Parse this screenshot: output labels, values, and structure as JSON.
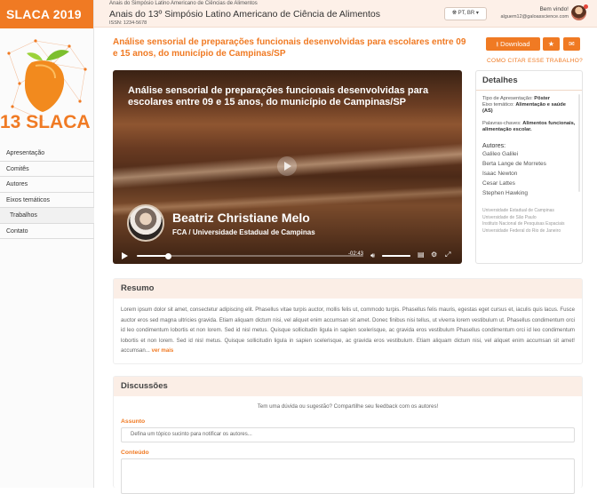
{
  "sidebar": {
    "brand": "SLACA 2019",
    "logo_text": "13 SLACA",
    "items": [
      {
        "label": "Apresentação"
      },
      {
        "label": "Comitês"
      },
      {
        "label": "Autores"
      },
      {
        "label": "Eixos temáticos"
      },
      {
        "label": "Trabalhos"
      },
      {
        "label": "Contato"
      }
    ]
  },
  "header": {
    "small": "Anais do Simpósio Latino Americano de Ciências de Alimentos",
    "title": "Anais do 13º Simpósio Latino Americano de Ciência de Alimentos",
    "issn": "ISSN: 1234-5678",
    "language": "PT, BR",
    "welcome": "Bem vindo!",
    "email": "alguem12@galoasscience.com"
  },
  "paper": {
    "title": "Análise sensorial de preparações funcionais desenvolvidas para escolares entre 09 e 15 anos, do município de Campinas/SP",
    "download_label": "Download",
    "cite_label": "COMO CITAR ESSE TRABALHO?"
  },
  "video": {
    "title": "Análise sensorial de preparações funcionais desenvolvidas para escolares entre 09 e 15 anos, do município de Campinas/SP",
    "speaker_name": "Beatriz Christiane Melo",
    "speaker_institution": "FCA / Universidade Estadual de Campinas",
    "time": "-02:43",
    "progress": 0.14,
    "volume": 1.0
  },
  "details": {
    "heading": "Detalhes",
    "type_label": "Tipo de Apresentação:",
    "type_value": "Pôster",
    "axis_label": "Eixo temático:",
    "axis_value": "Alimentação e saúde (AS)",
    "keywords_label": "Palavras-chaves:",
    "keywords_value": "Alimentos funcionais, alimentação escolar.",
    "authors_label": "Autores:",
    "authors": [
      {
        "name": "Galileo Galilei"
      },
      {
        "name": "Berta Lange de Morretes"
      },
      {
        "name": "Isaac Newton"
      },
      {
        "name": "Cesar Lattes"
      },
      {
        "name": "Stephen Hawking"
      }
    ],
    "institutions": [
      {
        "name": "Universidade Estadual de Campinas"
      },
      {
        "name": "Universidade de São Paulo"
      },
      {
        "name": "Instituto Nacional de Pesquisas Espaciais"
      },
      {
        "name": "Universidade Federal do Rio de Janeiro"
      }
    ]
  },
  "resumo": {
    "heading": "Resumo",
    "text": "Lorem ipsum dolor sit amet, consectetur adipiscing elit. Phasellus vitae turpis auctor, mollis felis ut, commodo turpis. Phasellus felis mauris, egestas eget cursus et, iaculis quis lacus. Fusce auctor eros sed magna ultricies gravida. Etiam aliquam dictum nisi, vel aliquet enim accumsan sit amet. Donec finibus nisi tellus, ut viverra lorem vestibulum ut. Phasellus condimentum orci id leo condimentum lobortis et non lorem. Sed id nisl metus. Quisque sollicitudin ligula in sapien scelerisque, ac gravida eros vestibulum Phasellus condimentum orci id leo condimentum lobortis et non lorem. Sed id nisl metus. Quisque sollicitudin ligula in sapien scelerisque, ac gravida eros vestibulum. Etiam aliquam dictum nisi, vel aliquet enim accumsan sit amet! accumsan...",
    "more": "ver mais"
  },
  "discussions": {
    "heading": "Discussões",
    "prompt": "Tem uma dúvida ou sugestão? Compartilhe seu feedback com os autores!",
    "subject_label": "Assunto",
    "subject_placeholder": "Defina um tópico sucinto para notificar os autores...",
    "content_label": "Conteúdo"
  },
  "colors": {
    "accent": "#f07a23",
    "header_bg": "#fdf0e8"
  }
}
